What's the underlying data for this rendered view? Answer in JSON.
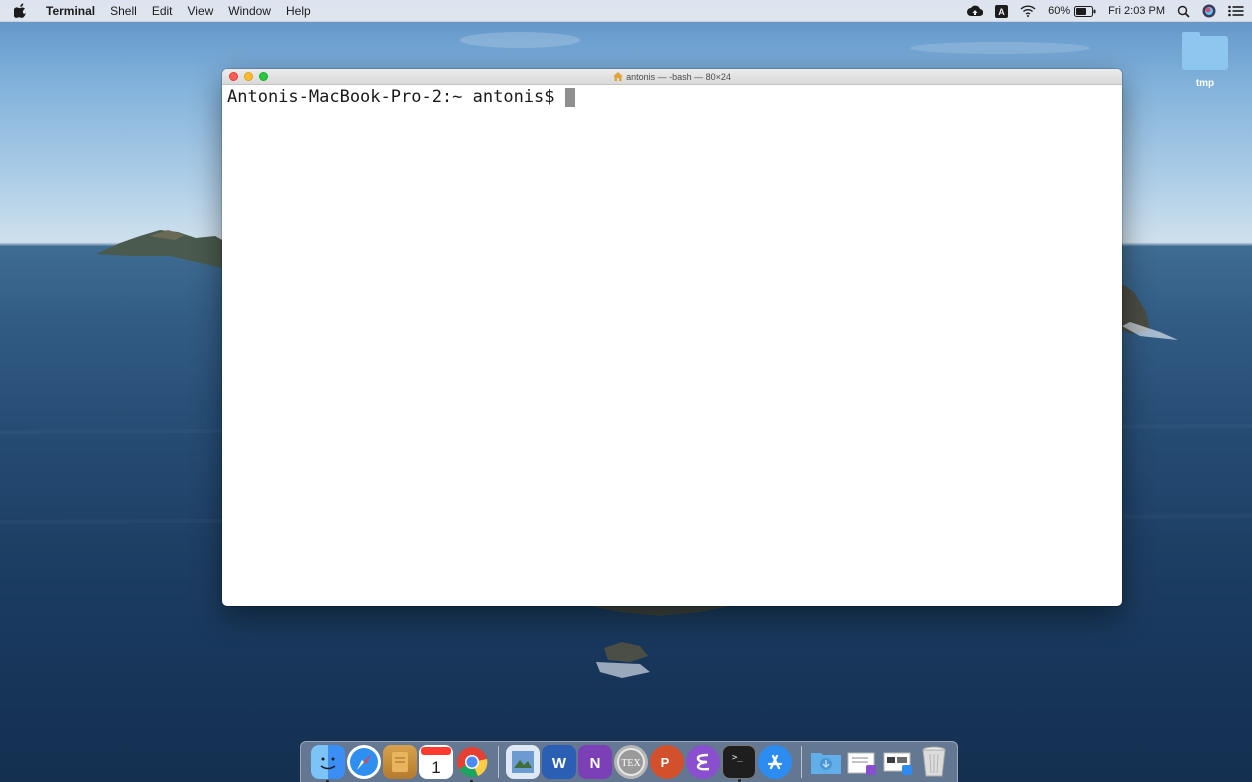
{
  "menubar": {
    "apple_icon": "apple-logo-icon",
    "app_name": "Terminal",
    "items": [
      "Shell",
      "Edit",
      "View",
      "Window",
      "Help"
    ],
    "status": {
      "cloud_icon": "cloud-sync-icon",
      "input_icon": "input-source-icon",
      "input_label": "A",
      "wifi_icon": "wifi-icon",
      "battery_percent": "60%",
      "battery_icon": "battery-icon",
      "clock": "Fri 2:03 PM",
      "search_icon": "spotlight-search-icon",
      "siri_icon": "siri-icon",
      "notification_icon": "notification-center-icon"
    }
  },
  "desktop": {
    "folder_label": "tmp"
  },
  "terminal": {
    "title": "antonis — -bash — 80×24",
    "prompt": "Antonis-MacBook-Pro-2:~ antonis$"
  },
  "dock": {
    "apps": [
      {
        "name": "finder",
        "icon": "finder-icon",
        "color": "#3a8ef6"
      },
      {
        "name": "safari",
        "icon": "safari-icon",
        "color": "#2f8ff0"
      },
      {
        "name": "notes",
        "icon": "notes-icon",
        "color": "#c8923c"
      },
      {
        "name": "calendar",
        "icon": "calendar-icon",
        "color": "#ffffff",
        "label": "1"
      },
      {
        "name": "chrome",
        "icon": "chrome-icon",
        "color": "#e44134"
      },
      {
        "name": "preview",
        "icon": "preview-icon",
        "color": "#6b9bd1"
      },
      {
        "name": "word",
        "icon": "word-icon",
        "color": "#2b5fb4",
        "label": "W"
      },
      {
        "name": "onenote",
        "icon": "onenote-icon",
        "color": "#7b3fb6",
        "label": "N"
      },
      {
        "name": "texshop",
        "icon": "tex-icon",
        "color": "#9a9a9a",
        "label": "TEX"
      },
      {
        "name": "powerpoint",
        "icon": "powerpoint-icon",
        "color": "#d2502c",
        "label": "P"
      },
      {
        "name": "emacs",
        "icon": "emacs-icon",
        "color": "#8a4fcf"
      },
      {
        "name": "terminal",
        "icon": "terminal-icon",
        "color": "#1e1e1e",
        "label": ">_"
      },
      {
        "name": "app-store",
        "icon": "app-store-icon",
        "color": "#2d8cf0"
      },
      {
        "name": "downloads",
        "icon": "downloads-folder-icon",
        "color": "#62aee9"
      },
      {
        "name": "documents-stack",
        "icon": "documents-stack-icon",
        "color": "#e8e8e8"
      },
      {
        "name": "screenshots-stack",
        "icon": "screenshots-stack-icon",
        "color": "#e8e8e8"
      },
      {
        "name": "trash",
        "icon": "trash-icon",
        "color": "#dcdcdc"
      }
    ]
  }
}
